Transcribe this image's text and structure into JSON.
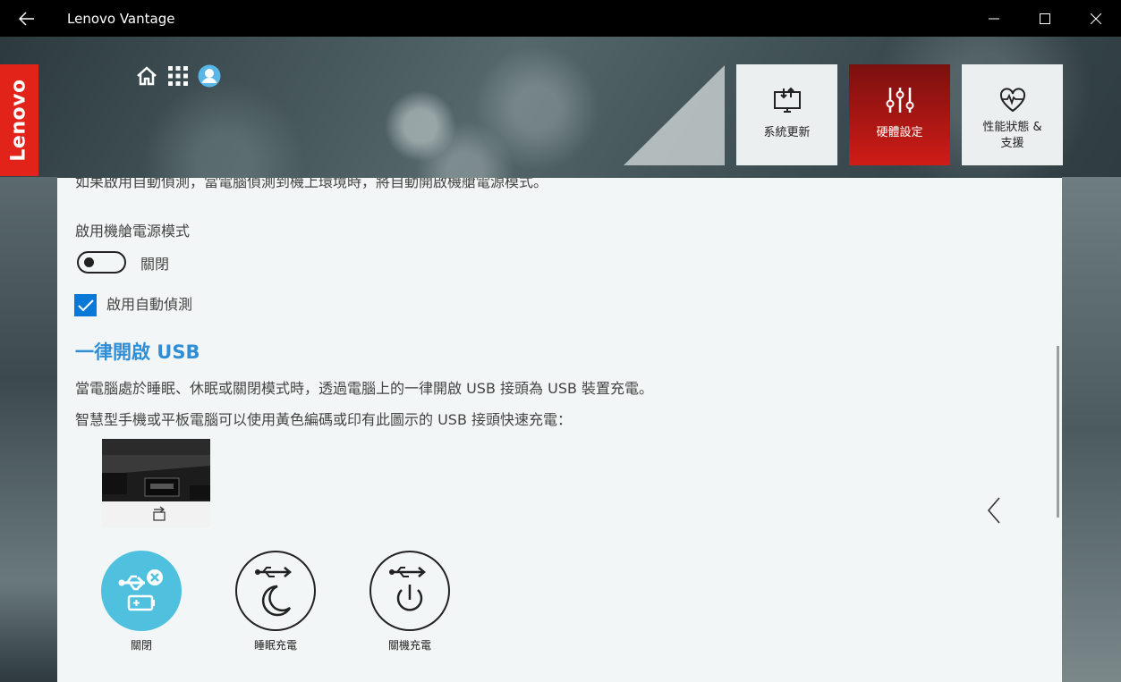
{
  "window": {
    "title": "Lenovo Vantage"
  },
  "brand": {
    "logo_text": "Lenovo",
    "accent": "#e2231a"
  },
  "tiles": [
    {
      "label": "系統更新",
      "icon": "monitor-download-icon"
    },
    {
      "label": "硬體設定",
      "icon": "sliders-icon",
      "active": true
    },
    {
      "label_line1": "性能狀態 &",
      "label_line2": "支援",
      "icon": "heart-pulse-icon"
    }
  ],
  "content": {
    "cut_line": "如果啟用自動偵測，當電腦偵測到機上環境時，將自動開啟機艙電源模式。",
    "dock_label": "啟用機艙電源模式",
    "toggle_state": "關閉",
    "auto_detect_label": "啟用自動偵測",
    "usb_section": {
      "title": "一律開啟 USB",
      "desc1": "當電腦處於睡眠、休眠或關閉模式時，透過電腦上的一律開啟 USB 接頭為 USB 裝置充電。",
      "desc2": "智慧型手機或平板電腦可以使用黃色編碼或印有此圖示的 USB 接頭快速充電："
    },
    "modes": [
      {
        "label": "關閉",
        "selected": true
      },
      {
        "label": "睡眠充電",
        "selected": false
      },
      {
        "label": "關機充電",
        "selected": false
      }
    ]
  },
  "colors": {
    "selected_mode": "#4fc1df",
    "section_title": "#2f8fd6",
    "checkbox": "#0a78d7",
    "active_tile": "#d01c16"
  }
}
